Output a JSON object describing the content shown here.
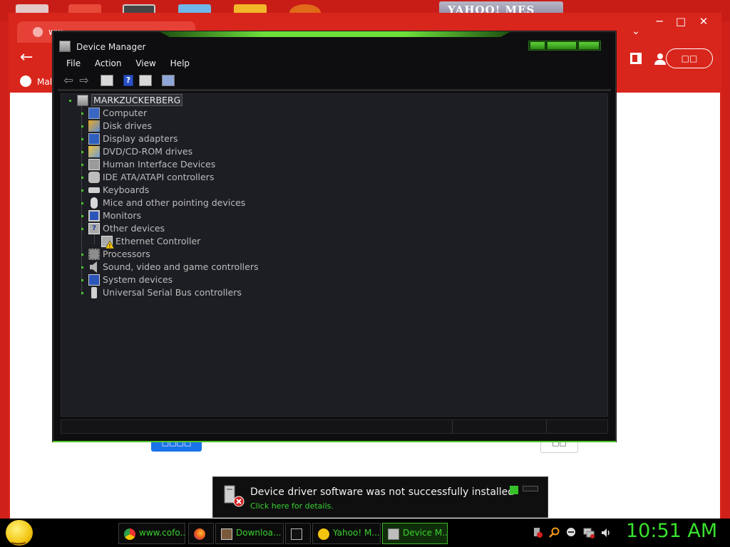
{
  "desktop": {
    "yahoo_title": "YAHOO! MES"
  },
  "browser": {
    "tab_title": "ww",
    "bookmark": "Mal",
    "profile_label": "□□",
    "blue_button": "□□□□",
    "outline_button": "□□"
  },
  "device_manager": {
    "title": "Device Manager",
    "menu": [
      "File",
      "Action",
      "View",
      "Help"
    ],
    "tree": {
      "root": "MARKZUCKERBERG",
      "items": [
        {
          "label": "Computer",
          "icon": "computer-icon"
        },
        {
          "label": "Disk drives",
          "icon": "disk-drive-icon"
        },
        {
          "label": "Display adapters",
          "icon": "display-adapter-icon"
        },
        {
          "label": "DVD/CD-ROM drives",
          "icon": "dvd-drive-icon"
        },
        {
          "label": "Human Interface Devices",
          "icon": "hid-icon"
        },
        {
          "label": "IDE ATA/ATAPI controllers",
          "icon": "ide-controller-icon"
        },
        {
          "label": "Keyboards",
          "icon": "keyboard-icon"
        },
        {
          "label": "Mice and other pointing devices",
          "icon": "mouse-icon"
        },
        {
          "label": "Monitors",
          "icon": "monitor-icon"
        },
        {
          "label": "Other devices",
          "icon": "unknown-device-icon"
        },
        {
          "label": "Ethernet Controller",
          "icon": "warning-device-icon"
        },
        {
          "label": "Processors",
          "icon": "processor-icon"
        },
        {
          "label": "Sound, video and game controllers",
          "icon": "speaker-icon"
        },
        {
          "label": "System devices",
          "icon": "system-device-icon"
        },
        {
          "label": "Universal Serial Bus controllers",
          "icon": "usb-icon"
        }
      ]
    }
  },
  "notification": {
    "title": "Device driver software was not successfully installed",
    "link": "Click here for details."
  },
  "taskbar": {
    "tasks": [
      "www.cofo...",
      "Downloa...",
      "",
      "Yahoo! M...",
      "Device M..."
    ],
    "clock": "10:51 AM"
  },
  "colors": {
    "accent_green": "#39d12f",
    "desktop_red": "#d0201a",
    "window_bg": "#0e0e10"
  }
}
